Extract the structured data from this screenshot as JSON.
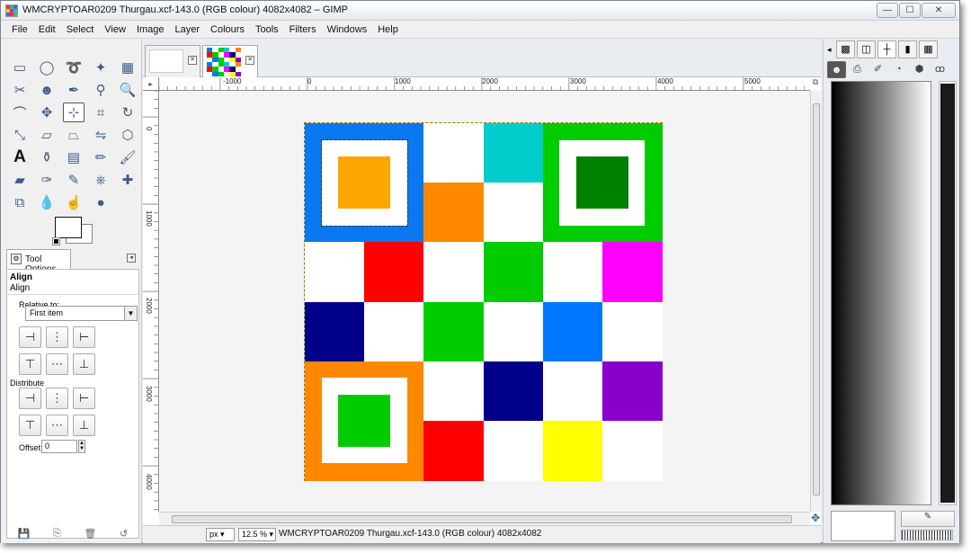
{
  "window": {
    "title": "WMCRYPTOAR0209 Thurgau.xcf-143.0 (RGB colour) 4082x4082 – GIMP",
    "minimize": "—",
    "maximize": "☐",
    "close": "✕"
  },
  "menu": [
    "File",
    "Edit",
    "Select",
    "View",
    "Image",
    "Layer",
    "Colours",
    "Tools",
    "Filters",
    "Windows",
    "Help"
  ],
  "toolbox": {
    "text_tool_letter": "A",
    "tool_options_tab": "Tool Options",
    "tool_options_header": "Align",
    "tool_options_sub": "Align",
    "relative_to_label": "Relative to:",
    "relative_to_value": "First item",
    "distribute_label": "Distribute",
    "offset_label": "Offset:",
    "offset_value": "0"
  },
  "rulers": {
    "h_labels": [
      "-1000",
      "0",
      "1000",
      "2000",
      "3000",
      "4000",
      "5000"
    ],
    "v_labels": [
      "0",
      "1000",
      "2000",
      "3000",
      "4000"
    ]
  },
  "statusbar": {
    "unit": "px",
    "zoom": "12.5 %",
    "message": "WMCRYPTOAR0209 Thurgau.xcf-143.0 (RGB colour) 4082x4082"
  },
  "image": {
    "colors": {
      "blue": "#0a78f0",
      "orange": "#ff8800",
      "amber": "#ffa500",
      "cyan": "#00cccc",
      "green": "#00cc00",
      "dark_green": "#008000",
      "red": "#ff0000",
      "magenta": "#ff00ff",
      "navy": "#000088",
      "azure": "#0077ff",
      "purple": "#8800cc",
      "yellow": "#ffff00",
      "white": "#ffffff"
    }
  }
}
